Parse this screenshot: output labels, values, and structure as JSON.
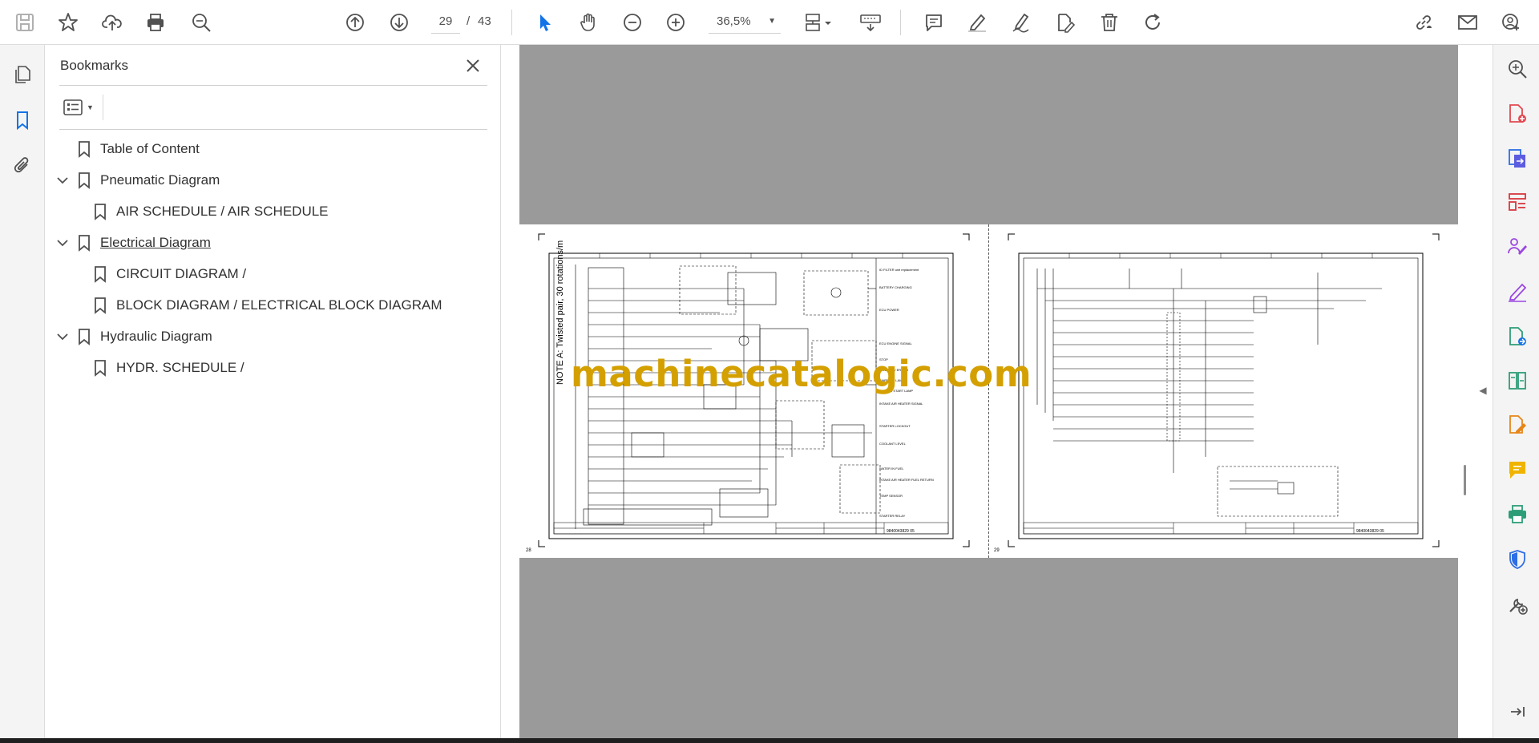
{
  "toolbar": {
    "page_current": "29",
    "page_separator": "/",
    "page_total": "43",
    "zoom": "36,5%"
  },
  "bookmarks": {
    "title": "Bookmarks",
    "items": [
      {
        "label": "Table of Content"
      },
      {
        "label": "Pneumatic Diagram"
      },
      {
        "label": "AIR SCHEDULE / AIR SCHEDULE"
      },
      {
        "label": "Electrical Diagram"
      },
      {
        "label": "CIRCUIT DIAGRAM /"
      },
      {
        "label": "BLOCK DIAGRAM / ELECTRICAL BLOCK DIAGRAM"
      },
      {
        "label": "Hydraulic Diagram"
      },
      {
        "label": "HYDR. SCHEDULE /"
      }
    ]
  },
  "document": {
    "watermark": "machinecatalogic.com",
    "left_page": {
      "side_note": "NOTE A: Twisted pair, 30 rotations/m",
      "page_no": "28",
      "doc_no": "9840043829 05",
      "labels": [
        "ID FILTER unit replacement",
        "BATTERY CHARGING",
        "ECU POWER",
        "ECU ENGINE SIGNAL",
        "STOP",
        "STARTER / ERROR",
        "WARNING LAMP",
        "WAIT TO START LAMP",
        "INTAKE AIR HEATER SIGNAL",
        "STARTER LOCKOUT",
        "COOLANT LEVEL",
        "WATER IN FUEL",
        "INTAKE AIR HEATER FUEL RETURN",
        "TEMP SENSOR",
        "STARTER RELAY"
      ]
    },
    "right_page": {
      "page_no": "29",
      "doc_no": "9840043829 05"
    }
  },
  "colors": {
    "watermark": "#d4a000",
    "bookmark_icon": "#1473e6",
    "panel_gray": "#9a9a9a"
  }
}
